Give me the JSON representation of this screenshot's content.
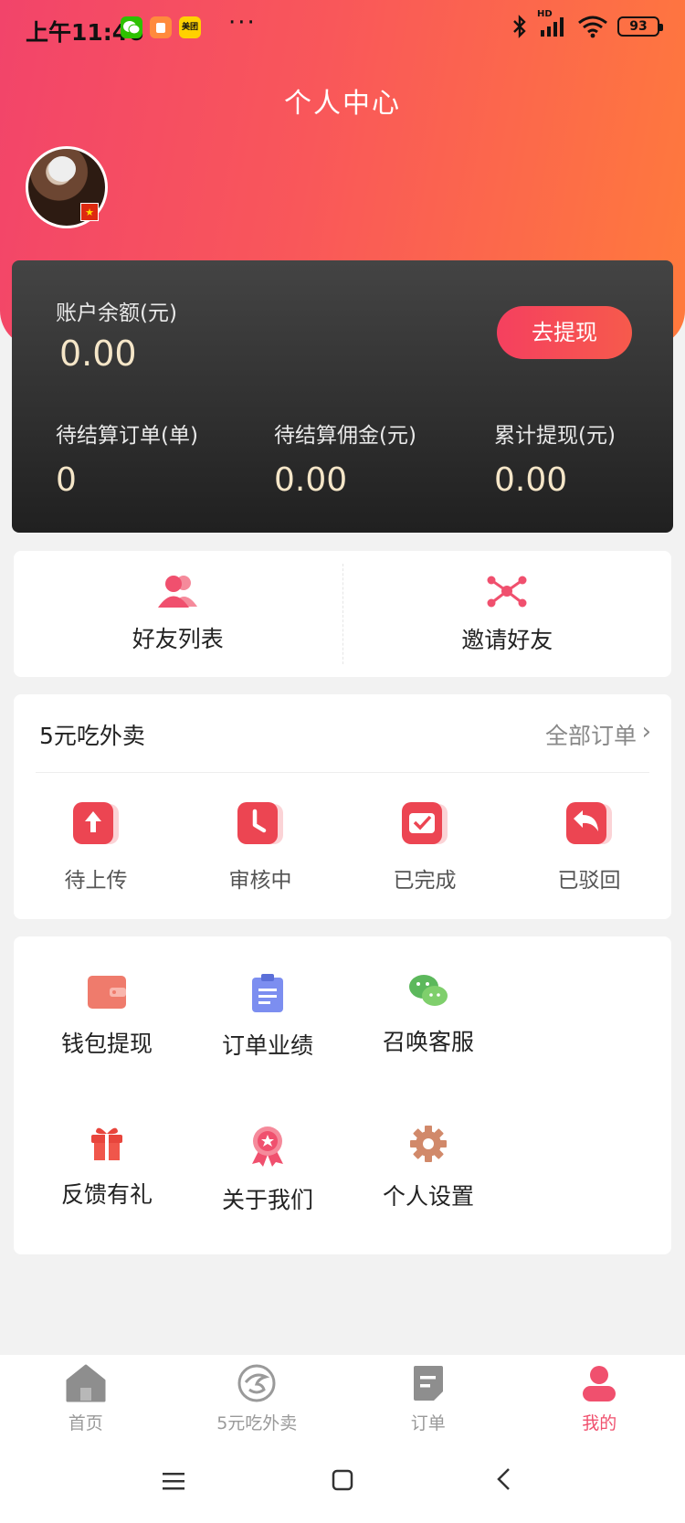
{
  "status_bar": {
    "time": "上午11:46",
    "meituan_label": "美团",
    "dots": "···",
    "battery": "93",
    "network": "HD"
  },
  "header": {
    "title": "个人中心"
  },
  "balance": {
    "label": "账户余额(元)",
    "value": "0.00",
    "withdraw_button": "去提现",
    "stats": [
      {
        "label": "待结算订单(单)",
        "value": "0"
      },
      {
        "label": "待结算佣金(元)",
        "value": "0.00"
      },
      {
        "label": "累计提现(元)",
        "value": "0.00"
      }
    ]
  },
  "friends": {
    "list_label": "好友列表",
    "invite_label": "邀请好友"
  },
  "orders": {
    "title": "5元吃外卖",
    "all_label": "全部订单",
    "items": [
      {
        "label": "待上传",
        "icon": "upload-icon"
      },
      {
        "label": "审核中",
        "icon": "clock-icon"
      },
      {
        "label": "已完成",
        "icon": "check-icon"
      },
      {
        "label": "已驳回",
        "icon": "return-icon"
      }
    ]
  },
  "services": [
    {
      "label": "钱包提现",
      "icon": "wallet-icon"
    },
    {
      "label": "订单业绩",
      "icon": "clipboard-icon"
    },
    {
      "label": "召唤客服",
      "icon": "wechat-icon"
    },
    {
      "label": "反馈有礼",
      "icon": "gift-icon"
    },
    {
      "label": "关于我们",
      "icon": "badge-icon"
    },
    {
      "label": "个人设置",
      "icon": "gear-icon"
    }
  ],
  "tabbar": [
    {
      "label": "首页",
      "active": false
    },
    {
      "label": "5元吃外卖",
      "active": false
    },
    {
      "label": "订单",
      "active": false
    },
    {
      "label": "我的",
      "active": true
    }
  ],
  "colors": {
    "accent": "#f0506e",
    "gradient_start": "#f2446a",
    "gradient_end": "#ff7a3c",
    "gold": "#f5e6c8"
  }
}
